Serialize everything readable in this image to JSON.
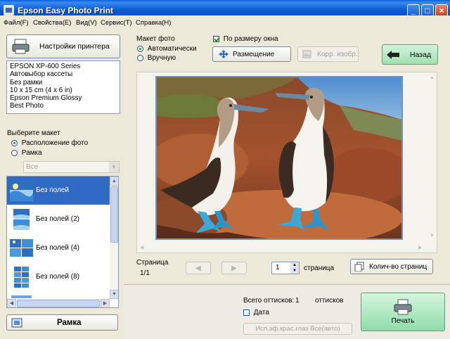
{
  "window": {
    "title": "Epson Easy Photo Print"
  },
  "menu": [
    "Файл(F)",
    "Свойства(E)",
    "Вид(V)",
    "Сервис(T)",
    "Справка(H)"
  ],
  "left": {
    "printer_settings_label": "Настройки принтера",
    "printer_info": [
      "EPSON XP-600 Series",
      "Автовыбор кассеты",
      "Без рамки",
      "10 x 15 cm (4 x 6 in)",
      "Epson Premium Glossy",
      "Best Photo"
    ],
    "choose_layout_label": "Выберите макет",
    "layout_options": [
      "Расположение фото",
      "Рамка"
    ],
    "filter_value": "Все",
    "layouts": [
      "Без полей",
      "Без полей (2)",
      "Без полей (4)",
      "Без полей (8)"
    ],
    "frame_button_label": "Рамка"
  },
  "right": {
    "photo_layout_label": "Макет фото",
    "auto_label": "Автоматически",
    "manual_label": "Вручную",
    "fit_window_label": "По размеру окна",
    "placement_label": "Размещение",
    "correct_label": "Корр. изобр.",
    "back_label": "Назад",
    "page_label": "Страница",
    "page_value": "1/1",
    "page_count_input": "1",
    "pages_unit": "страница",
    "page_count_button": "Колич-во страниц",
    "total_prints_label": "Всего оттисков:",
    "total_prints_value": "1",
    "prints_unit": "оттисков",
    "date_label": "Дата",
    "redeye_label": "Исп.эф.крас.глаз Все(авто)",
    "print_label": "Печать"
  },
  "colors": {
    "title_bar": "#0b5bd6",
    "selection": "#316ac5",
    "print_button": "#8fdcaa",
    "back_button": "#9fe0b2"
  }
}
